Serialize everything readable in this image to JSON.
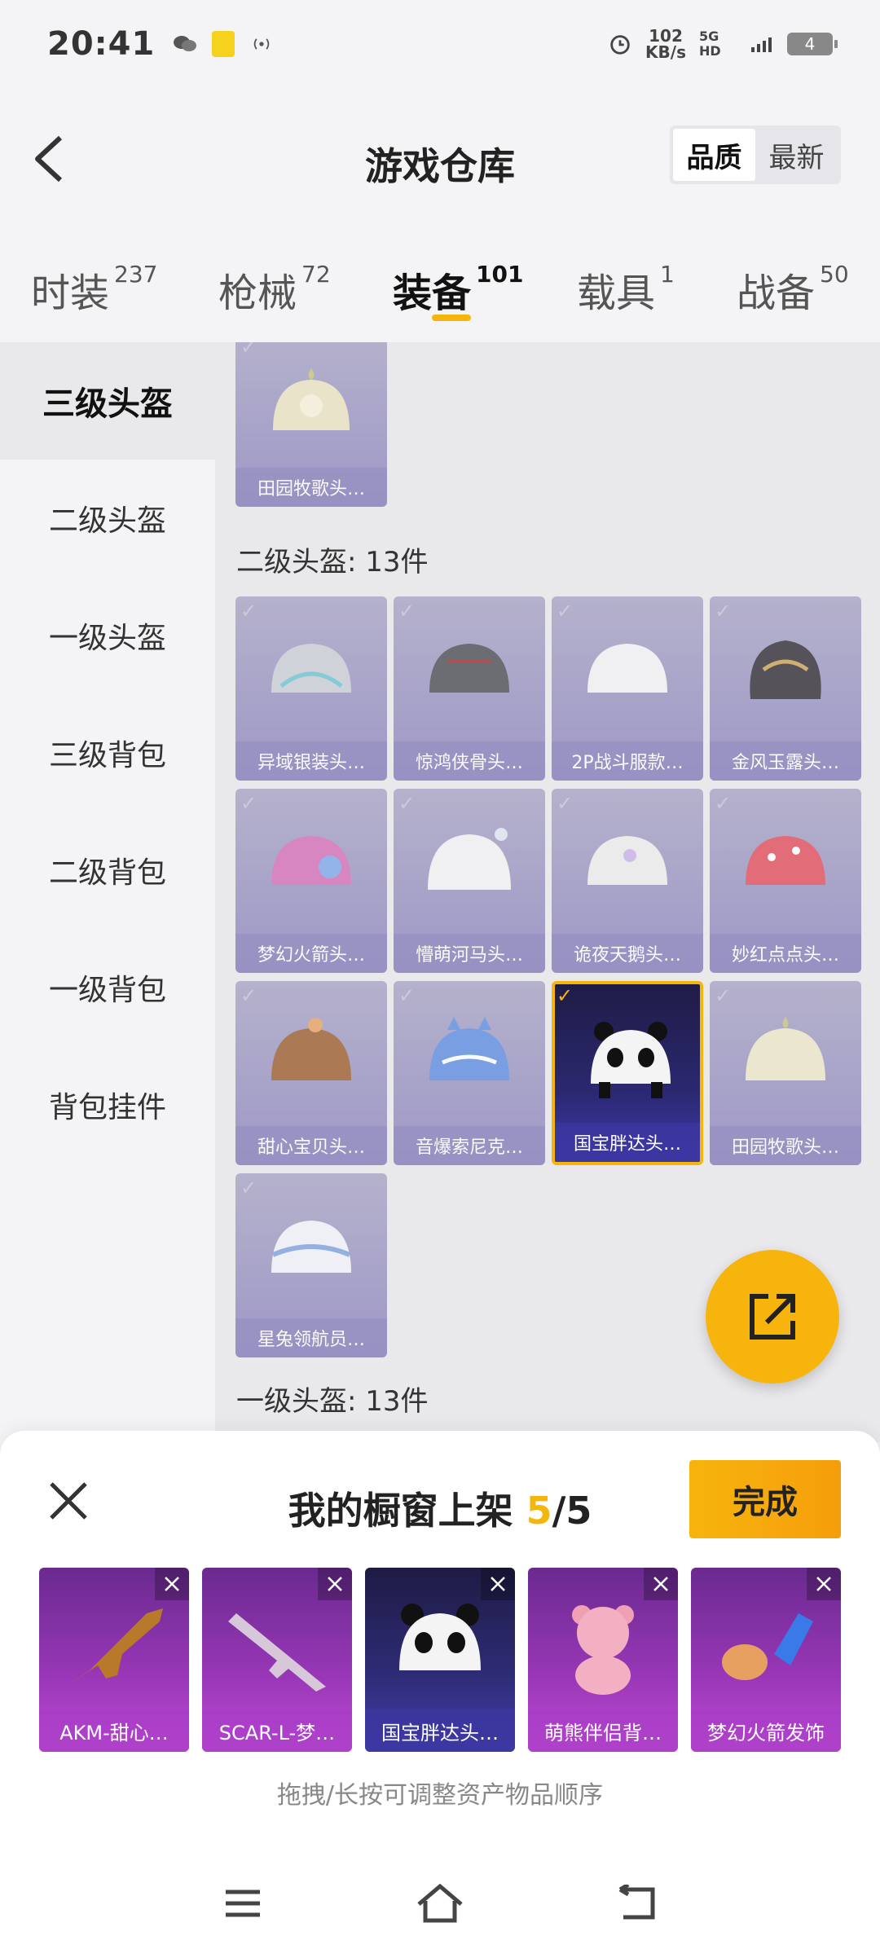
{
  "status_bar": {
    "time": "20:41",
    "speed_value": "102",
    "speed_unit": "KB/s",
    "network": "5G HD",
    "battery": "4"
  },
  "header": {
    "title": "游戏仓库",
    "sort_options": [
      "品质",
      "最新"
    ],
    "sort_selected": "品质"
  },
  "tabs": [
    {
      "label": "时装",
      "count": "237"
    },
    {
      "label": "枪械",
      "count": "72"
    },
    {
      "label": "装备",
      "count": "101",
      "active": true
    },
    {
      "label": "载具",
      "count": "1"
    },
    {
      "label": "战备",
      "count": "50"
    }
  ],
  "sidebar": {
    "items": [
      "三级头盔",
      "二级头盔",
      "一级头盔",
      "三级背包",
      "二级背包",
      "一级背包",
      "背包挂件"
    ],
    "active": "三级头盔"
  },
  "grid": {
    "top_partial_item": "田园牧歌头…",
    "section_two_title": "二级头盔: 13件",
    "items": [
      "异域银装头…",
      "惊鸿侠骨头…",
      "2P战斗服款…",
      "金风玉露头…",
      "梦幻火箭头…",
      "懵萌河马头…",
      "诡夜天鹅头…",
      "妙红点点头…",
      "甜心宝贝头…",
      "音爆索尼克…",
      "国宝胖达头…",
      "田园牧歌头…",
      "星兔领航员…"
    ],
    "selected_item": "国宝胖达头…",
    "section_one_title": "一级头盔: 13件"
  },
  "sheet": {
    "title_prefix": "我的橱窗上架",
    "count_current": "5",
    "count_separator": "/",
    "count_total": "5",
    "done_label": "完成",
    "items": [
      "AKM-甜心…",
      "SCAR-L-梦…",
      "国宝胖达头…",
      "萌熊伴侣背…",
      "梦幻火箭发饰"
    ],
    "hint": "拖拽/长按可调整资产物品顺序"
  },
  "colors": {
    "accent": "#f5b50a",
    "card_purple": "#958fbf",
    "card_selected": "#2b2870",
    "shelf_magenta": "#9a37b8"
  }
}
